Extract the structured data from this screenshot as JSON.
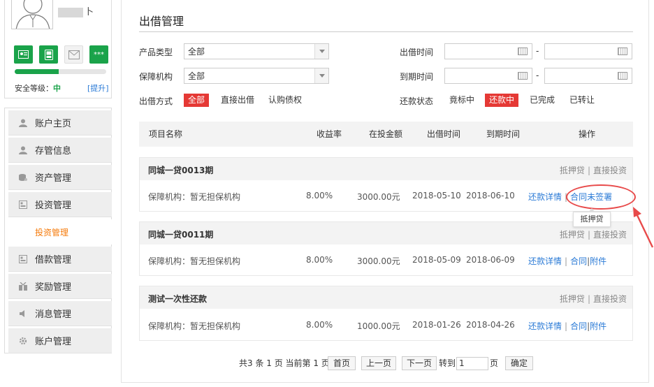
{
  "user": {
    "name_suffix": "卜",
    "security_label": "安全等级：",
    "security_level": "中",
    "upgrade_label": "[提升]",
    "security_progress": 0.48
  },
  "verify_icons": [
    {
      "name": "id-card-icon",
      "state": "on",
      "glyph": "▣"
    },
    {
      "name": "phone-icon",
      "state": "on",
      "glyph": "▤"
    },
    {
      "name": "email-icon",
      "state": "off",
      "glyph": "✉"
    },
    {
      "name": "password-icon",
      "state": "on",
      "glyph": "***"
    }
  ],
  "menu": {
    "items": [
      {
        "label": "账户主页",
        "icon": "user-icon"
      },
      {
        "label": "存管信息",
        "icon": "user-icon"
      },
      {
        "label": "资产管理",
        "icon": "asset-icon"
      },
      {
        "label": "投资管理",
        "icon": "invest-icon"
      },
      {
        "label": "借款管理",
        "icon": "loan-icon"
      },
      {
        "label": "奖励管理",
        "icon": "gift-icon"
      },
      {
        "label": "消息管理",
        "icon": "speaker-icon"
      },
      {
        "label": "账户管理",
        "icon": "gear-icon"
      }
    ],
    "active_sub": "投资管理"
  },
  "page": {
    "title": "出借管理"
  },
  "filters": {
    "product_type_label": "产品类型",
    "product_type_value": "全部",
    "guarantor_label": "保障机构",
    "guarantor_value": "全部",
    "lend_time_label": "出借时间",
    "due_time_label": "到期时间",
    "dash": "-",
    "lend_method_label": "出借方式",
    "lend_methods": [
      "全部",
      "直接出借",
      "认购债权"
    ],
    "lend_method_active": 0,
    "repay_status_label": "还款状态",
    "repay_statuses": [
      "竟标中",
      "还款中",
      "已完成",
      "已转让"
    ],
    "repay_status_active": 1
  },
  "table": {
    "headers": [
      "项目名称",
      "收益率",
      "在投金额",
      "出借时间",
      "到期时间",
      "操作"
    ],
    "rows": [
      {
        "name": "同城一贷0013期",
        "tag1": "抵押贷",
        "tag2": "直接投资",
        "guarantor": "保障机构：暂无担保机构",
        "rate": "8.00%",
        "amount": "3000.00元",
        "lend_date": "2018-05-10",
        "due_date": "2018-06-10",
        "action1": "还款详情",
        "action2": "合同未签署",
        "action3": ""
      },
      {
        "name": "同城一贷0011期",
        "tag1": "抵押贷",
        "tag2": "直接投资",
        "guarantor": "保障机构：暂无担保机构",
        "rate": "8.00%",
        "amount": "3000.00元",
        "lend_date": "2018-05-09",
        "due_date": "2018-06-09",
        "action1": "还款详情",
        "action2": "合同",
        "action3": "附件"
      },
      {
        "name": "测试一次性还款",
        "tag1": "抵押贷",
        "tag2": "直接投资",
        "guarantor": "保障机构：暂无担保机构",
        "rate": "8.00%",
        "amount": "1000.00元",
        "lend_date": "2018-01-26",
        "due_date": "2018-04-26",
        "action1": "还款详情",
        "action2": "合同",
        "action3": "附件"
      }
    ],
    "divider": "|",
    "tooltip": "抵押贷"
  },
  "pagination": {
    "summary": "共3 条 1 页 当前第 1 页",
    "first": "首页",
    "prev": "上一页",
    "next": "下一页",
    "goto_label": "转到",
    "page_input": "1",
    "page_unit": "页",
    "confirm": "确定"
  },
  "colors": {
    "accent_red": "#e53935",
    "link_blue": "#2a7ad6",
    "green": "#1aa34a",
    "orange": "#f57a0a"
  }
}
